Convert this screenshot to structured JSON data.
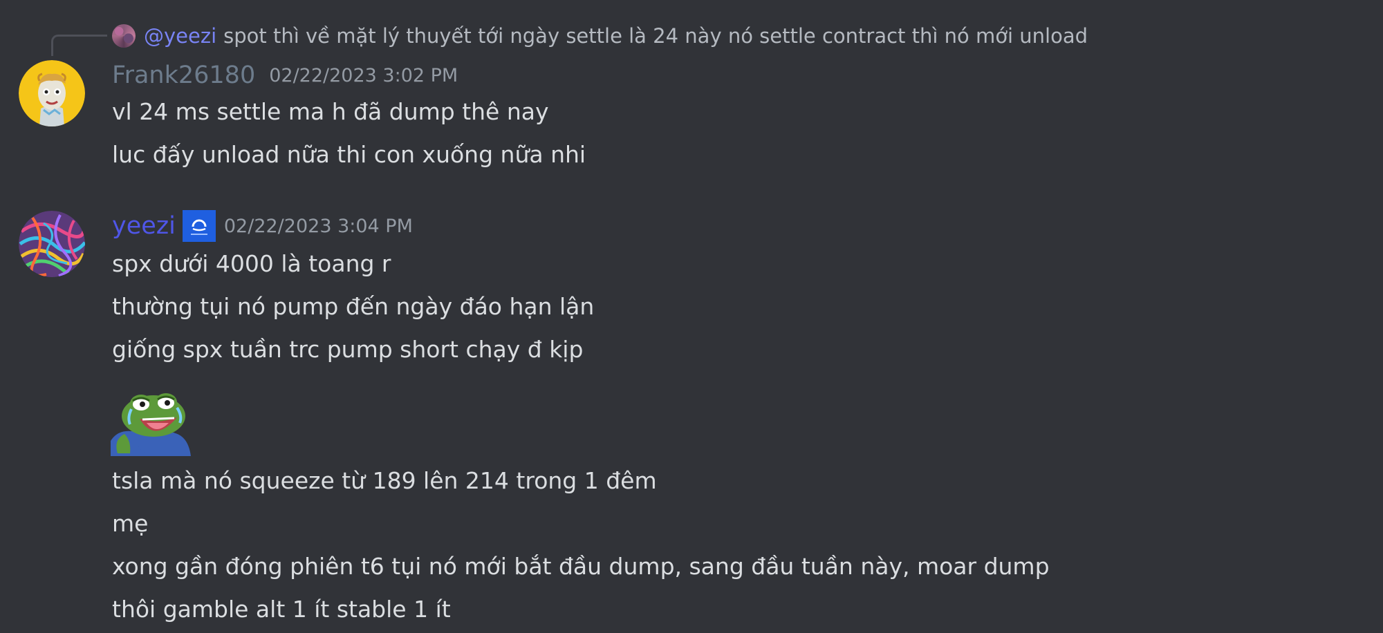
{
  "reply": {
    "mention": "@yeezi",
    "text": "spot thì về mặt lý thuyết tới ngày settle là 24 này nó settle contract thì nó mới unload"
  },
  "messages": [
    {
      "username": "Frank26180",
      "timestamp": "02/22/2023 3:02 PM",
      "username_color": "#6d7c8c",
      "lines": [
        "vl 24 ms settle ma h đã dump thê nay",
        "luc đấy unload nữa thi con xuống nữa nhi"
      ]
    },
    {
      "username": "yeezi",
      "timestamp": "02/22/2023 3:04 PM",
      "username_color": "#4f56e8",
      "lines_before_emoji": [
        "spx dưới 4000 là toang r",
        "thường tụi nó pump đến ngày đáo hạn lận",
        "giống spx tuần trc pump short chạy đ kịp"
      ],
      "emoji": "pepe-laughing-crying-emoji",
      "lines_after_emoji": [
        "tsla mà nó squeeze từ 189 lên 214 trong 1 đêm",
        "mẹ",
        "xong gần đóng phiên t6 tụi nó mới bắt đầu dump, sang đầu tuần này, moar dump",
        "thôi gamble alt 1 ít stable 1 ít"
      ]
    }
  ],
  "colors": {
    "background": "#313338",
    "text": "#dbdee1",
    "muted": "#949ba4",
    "mention": "#7984f5"
  }
}
